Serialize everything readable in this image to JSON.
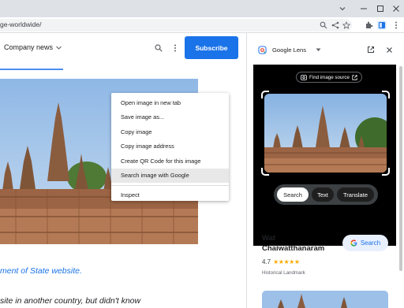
{
  "browser": {
    "url": "ge-worldwide/"
  },
  "page": {
    "nav": {
      "company_news": "Company news",
      "subscribe": "Subscribe"
    },
    "link_text": "ment of State website.",
    "body_text": "site in another country, but didn't know"
  },
  "context_menu": {
    "items": [
      "Open image in new tab",
      "Save image as...",
      "Copy image",
      "Copy image address",
      "Create QR Code for this image",
      "Search image with Google",
      "Inspect"
    ]
  },
  "lens": {
    "title": "Google Lens",
    "find_source": "Find image source",
    "chips": [
      "Search",
      "Text",
      "Translate"
    ],
    "result": {
      "title_line1": "Wat",
      "title_line2": "Chaiwatthanaram",
      "rating": "4.7",
      "stars": "★★★★★",
      "type": "Historical Landmark",
      "search_label": "Search"
    }
  },
  "colors": {
    "accent": "#1a73e8",
    "star": "#f9ab00"
  }
}
